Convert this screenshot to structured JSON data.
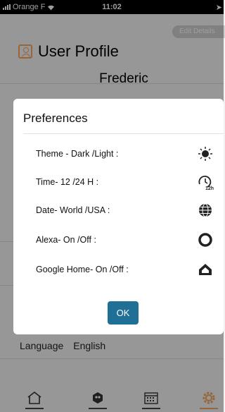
{
  "status_bar": {
    "carrier": "Orange F",
    "time": "11:02"
  },
  "page": {
    "edit_details": "Edit Details",
    "title": "User Profile",
    "user_name": "Frederic",
    "language_label": "Language",
    "language_value": "English"
  },
  "tabs": [
    {
      "name": "home-icon"
    },
    {
      "name": "bot-icon"
    },
    {
      "name": "calendar-icon"
    },
    {
      "name": "settings-icon"
    }
  ],
  "modal": {
    "title": "Preferences",
    "items": [
      {
        "label": "Theme - Dark /Light :",
        "icon": "sun-icon"
      },
      {
        "label": "Time- 12 /24 H :",
        "icon": "clock-12h-icon"
      },
      {
        "label": "Date- World /USA :",
        "icon": "globe-icon"
      },
      {
        "label": "Alexa- On /Off :",
        "icon": "alexa-ring-icon"
      },
      {
        "label": "Google Home- On /Off :",
        "icon": "google-home-icon"
      }
    ],
    "ok_label": "OK"
  },
  "colors": {
    "accent": "#1f6f97",
    "profile_icon": "#f2a35e"
  }
}
